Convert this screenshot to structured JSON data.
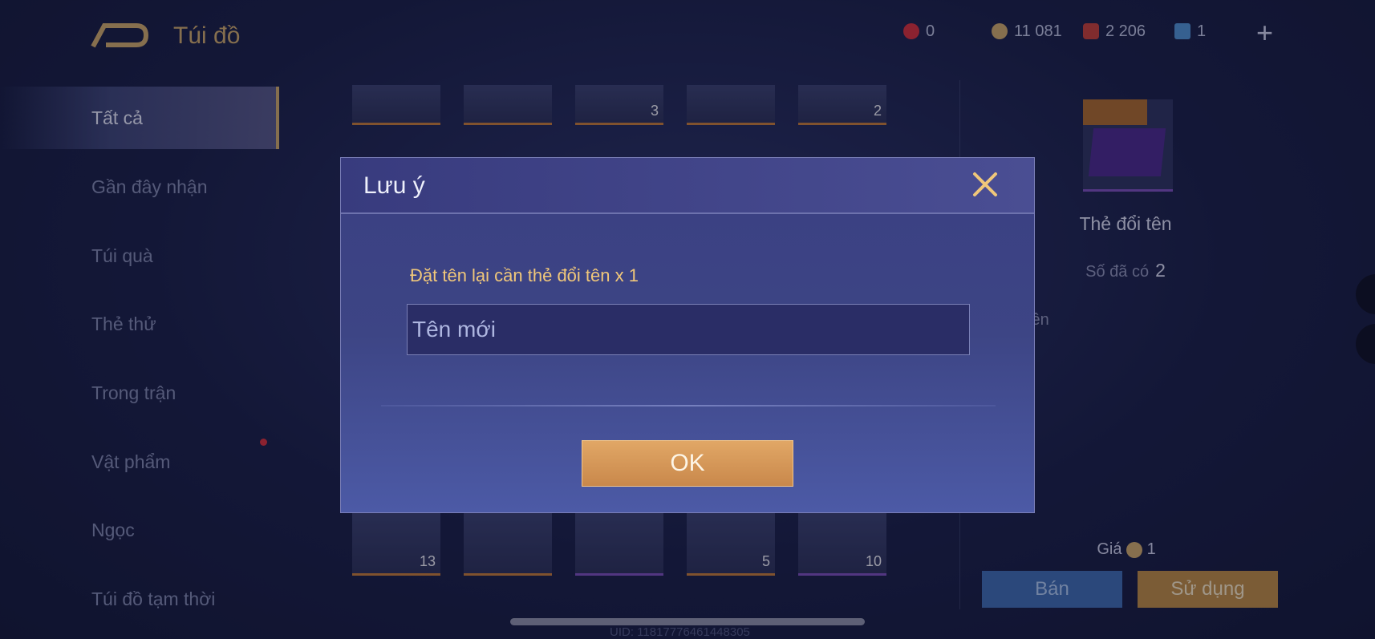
{
  "header": {
    "title": "Túi đồ",
    "currencies": [
      {
        "icon": "red-token-icon",
        "value": "0",
        "color": "#d2303c"
      },
      {
        "icon": "gold-coin-icon",
        "value": "11 081",
        "color": "#c9a66b"
      },
      {
        "icon": "red-gem-icon",
        "value": "2 206",
        "color": "#c0403a"
      },
      {
        "icon": "blue-card-icon",
        "value": "1",
        "color": "#4f8fd0"
      }
    ]
  },
  "sidebar": {
    "items": [
      {
        "label": "Tất cả"
      },
      {
        "label": "Gần đây nhận"
      },
      {
        "label": "Túi quà"
      },
      {
        "label": "Thẻ thử"
      },
      {
        "label": "Trong trận"
      },
      {
        "label": "Vật phẩm"
      },
      {
        "label": "Ngọc"
      },
      {
        "label": "Túi đồ tạm thời"
      }
    ]
  },
  "grid": {
    "top_counts": [
      "",
      "",
      "3",
      "",
      "2"
    ],
    "bottom_counts": [
      "13",
      "",
      "",
      "5",
      "10"
    ]
  },
  "detail": {
    "item_name": "Thẻ đổi tên",
    "owned_label": "Số đã có",
    "owned_count": "2",
    "desc_fragment": "i tên",
    "price_label": "Giá",
    "price_value": "1",
    "sell_label": "Bán",
    "use_label": "Sử dụng"
  },
  "dialog": {
    "title": "Lưu ý",
    "message": "Đặt tên lại cần thẻ đổi tên x 1",
    "input_placeholder": "Tên mới",
    "input_value": "",
    "ok_label": "OK"
  },
  "footer": {
    "uid": "UID: 11817776461448305"
  }
}
